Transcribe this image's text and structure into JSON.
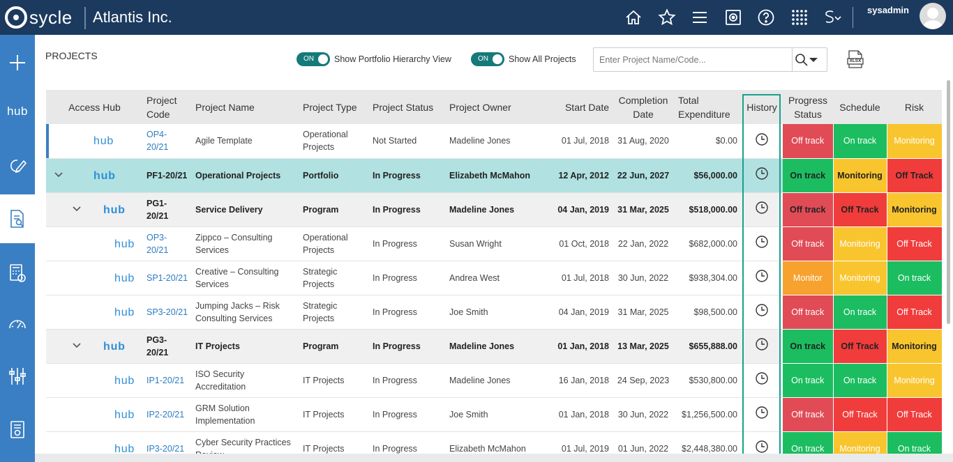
{
  "app": {
    "logo_text": "sycle",
    "company": "Atlantis Inc.",
    "username": "sysadmin"
  },
  "colors": {
    "topbar": "#1c3a5e",
    "sidenav": "#3a7fc3",
    "toggle": "#157a7a",
    "off_track": "#e04b56",
    "off_track_bold": "#f13c3c",
    "on_track": "#1bbd60",
    "monitoring": "#f9c52e",
    "monitor": "#f7a12e",
    "portfolio_row": "#b1e1e1",
    "history_frame": "#17a28c"
  },
  "top_icons": [
    "home-icon",
    "star-icon",
    "menu-icon",
    "settings-icon",
    "help-icon",
    "apps-grid-icon",
    "sycle-switch-icon"
  ],
  "sidenav": {
    "hub_label": "hub"
  },
  "page": {
    "title": "PROJECTS"
  },
  "toggles": {
    "portfolio": {
      "state": "ON",
      "label": "Show Portfolio Hierarchy View"
    },
    "all_projects": {
      "state": "ON",
      "label": "Show All Projects"
    }
  },
  "search": {
    "placeholder": "Enter Project Name/Code..."
  },
  "export": {
    "label": "XLSX"
  },
  "columns": {
    "access_hub": "Access Hub",
    "project_code": "Project Code",
    "project_name": "Project Name",
    "project_type": "Project Type",
    "project_status": "Project Status",
    "project_owner": "Project Owner",
    "start_date": "Start Date",
    "completion_date": "Completion Date",
    "total_expenditure": "Total Expenditure",
    "history": "History",
    "progress_status": "Progress Status",
    "schedule": "Schedule",
    "risk": "Risk"
  },
  "hub_label": "hub",
  "rows": [
    {
      "code": "OP4-20/21",
      "name": "Agile Template",
      "type": "Operational Projects",
      "status": "Not Started",
      "owner": "Madeline Jones",
      "start": "01 Jul, 2018",
      "completion": "31 Aug, 2020",
      "expenditure": "$0.00",
      "progress": "Off track",
      "schedule": "On track",
      "risk": "Monitoring"
    },
    {
      "code": "PF1-20/21",
      "name": "Operational Projects",
      "type": "Portfolio",
      "status": "In Progress",
      "owner": "Elizabeth McMahon",
      "start": "12 Apr, 2012",
      "completion": "22 Jun, 2027",
      "expenditure": "$56,000.00",
      "progress": "On track",
      "schedule": "Monitoring",
      "risk": "Off Track"
    },
    {
      "code": "PG1-20/21",
      "name": "Service Delivery",
      "type": "Program",
      "status": "In Progress",
      "owner": "Madeline Jones",
      "start": "04 Jan, 2019",
      "completion": "31 Mar, 2025",
      "expenditure": "$518,000.00",
      "progress": "Off track",
      "schedule": "Off Track",
      "risk": "Monitoring"
    },
    {
      "code": "OP3-20/21",
      "name": "Zippco – Consulting Services",
      "type": "Operational Projects",
      "status": "In Progress",
      "owner": "Susan Wright",
      "start": "01 Oct, 2018",
      "completion": "22 Jan, 2022",
      "expenditure": "$682,000.00",
      "progress": "Off track",
      "schedule": "Monitoring",
      "risk": "Off Track"
    },
    {
      "code": "SP1-20/21",
      "name": "Creative – Consulting Services",
      "type": "Strategic Projects",
      "status": "In Progress",
      "owner": "Andrea West",
      "start": "01 Jul, 2018",
      "completion": "30 Jun, 2022",
      "expenditure": "$938,304.00",
      "progress": "Monitor",
      "schedule": "Monitoring",
      "risk": "On track"
    },
    {
      "code": "SP3-20/21",
      "name": "Jumping Jacks – Risk Consulting Services",
      "type": "Strategic Projects",
      "status": "In Progress",
      "owner": "Joe Smith",
      "start": "04 Jan, 2019",
      "completion": "31 Mar, 2025",
      "expenditure": "$98,500.00",
      "progress": "Off track",
      "schedule": "On track",
      "risk": "Off Track"
    },
    {
      "code": "PG3-20/21",
      "name": "IT Projects",
      "type": "Program",
      "status": "In Progress",
      "owner": "Madeline Jones",
      "start": "01 Jan, 2018",
      "completion": "13 Mar, 2025",
      "expenditure": "$655,888.00",
      "progress": "On track",
      "schedule": "Off Track",
      "risk": "Monitoring"
    },
    {
      "code": "IP1-20/21",
      "name": "ISO Security Accreditation",
      "type": "IT Projects",
      "status": "In Progress",
      "owner": "Madeline Jones",
      "start": "16 Jan, 2018",
      "completion": "24 Sep, 2023",
      "expenditure": "$530,800.00",
      "progress": "On track",
      "schedule": "On track",
      "risk": "Monitoring"
    },
    {
      "code": "IP2-20/21",
      "name": "GRM Solution Implementation",
      "type": "IT Projects",
      "status": "In Progress",
      "owner": "Joe Smith",
      "start": "01 Jan, 2018",
      "completion": "30 Jun, 2022",
      "expenditure": "$1,256,500.00",
      "progress": "Off track",
      "schedule": "Off Track",
      "risk": "Off Track"
    },
    {
      "code": "IP3-20/21",
      "name": "Cyber Security Practices Review",
      "type": "IT Projects",
      "status": "In Progress",
      "owner": "Elizabeth McMahon",
      "start": "01 Jul, 2019",
      "completion": "01 Jun, 2022",
      "expenditure": "$2,448,380.00",
      "progress": "On track",
      "schedule": "Monitoring",
      "risk": "On track"
    }
  ]
}
